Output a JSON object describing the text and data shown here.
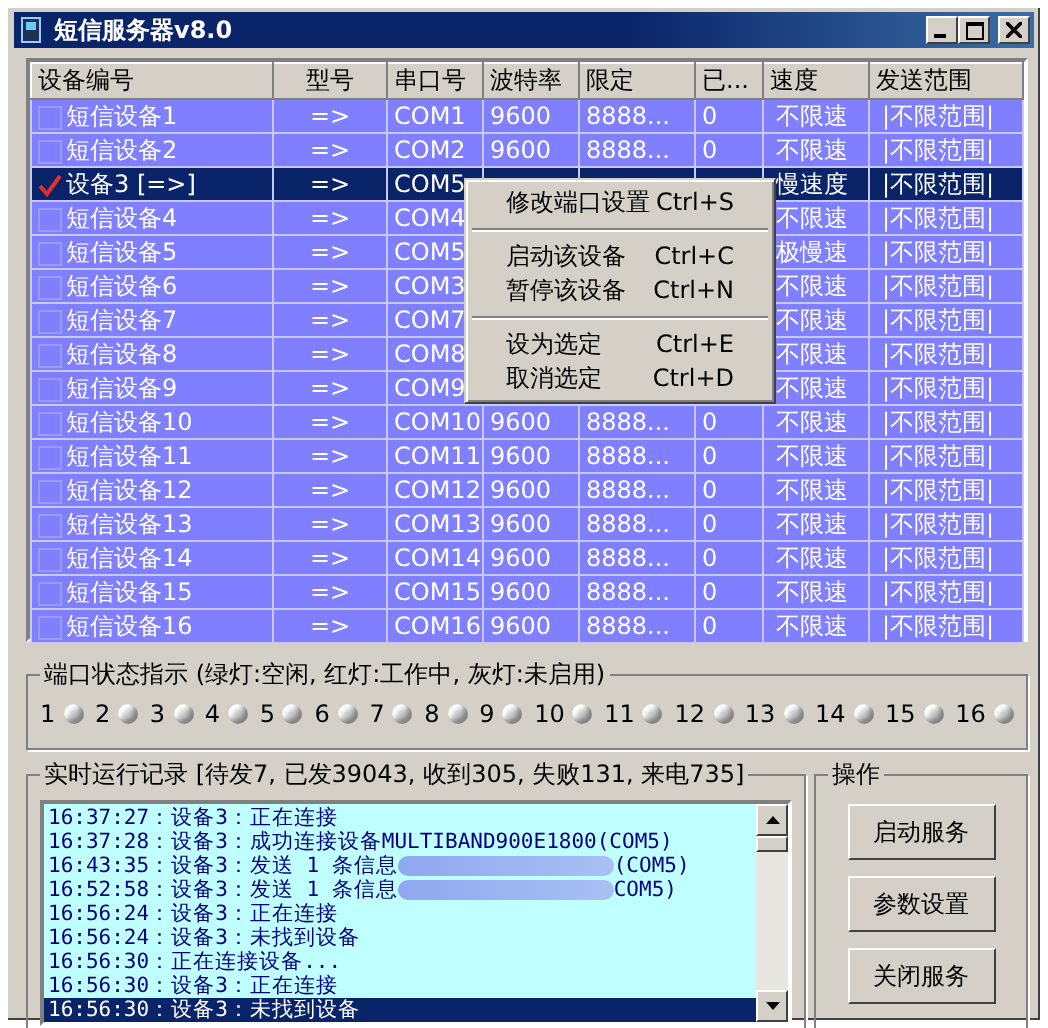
{
  "window": {
    "title": "短信服务器v8.0"
  },
  "table": {
    "columns": [
      "设备编号",
      "型号",
      "串口号",
      "波特率",
      "限定",
      "已...",
      "速度",
      "发送范围"
    ],
    "rows": [
      {
        "checked": false,
        "selected": false,
        "cells": {
          "name": "短信设备1",
          "model": "=>",
          "port": "COM1",
          "baud": "9600",
          "limit": "8888...",
          "sent": "0",
          "speed": "不限速",
          "range": "|不限范围|"
        }
      },
      {
        "checked": false,
        "selected": false,
        "cells": {
          "name": "短信设备2",
          "model": "=>",
          "port": "COM2",
          "baud": "9600",
          "limit": "8888...",
          "sent": "0",
          "speed": "不限速",
          "range": "|不限范围|"
        }
      },
      {
        "checked": true,
        "selected": true,
        "cells": {
          "name": "设备3 [=>]",
          "model": "=>",
          "port": "COM5",
          "speed": "慢速度",
          "range": "|不限范围|"
        }
      },
      {
        "checked": false,
        "selected": false,
        "cells": {
          "name": "短信设备4",
          "model": "=>",
          "port": "COM4",
          "speed": "不限速",
          "range": "|不限范围|"
        }
      },
      {
        "checked": false,
        "selected": false,
        "cells": {
          "name": "短信设备5",
          "model": "=>",
          "port": "COM5",
          "speed": "极慢速",
          "range": "|不限范围|"
        }
      },
      {
        "checked": false,
        "selected": false,
        "cells": {
          "name": "短信设备6",
          "model": "=>",
          "port": "COM3",
          "speed": "不限速",
          "range": "|不限范围|"
        }
      },
      {
        "checked": false,
        "selected": false,
        "cells": {
          "name": "短信设备7",
          "model": "=>",
          "port": "COM7",
          "speed": "不限速",
          "range": "|不限范围|"
        }
      },
      {
        "checked": false,
        "selected": false,
        "cells": {
          "name": "短信设备8",
          "model": "=>",
          "port": "COM8",
          "speed": "不限速",
          "range": "|不限范围|"
        }
      },
      {
        "checked": false,
        "selected": false,
        "cells": {
          "name": "短信设备9",
          "model": "=>",
          "port": "COM9",
          "speed": "不限速",
          "range": "|不限范围|"
        }
      },
      {
        "checked": false,
        "selected": false,
        "cells": {
          "name": "短信设备10",
          "model": "=>",
          "port": "COM10",
          "baud": "9600",
          "limit": "8888...",
          "sent": "0",
          "speed": "不限速",
          "range": "|不限范围|"
        }
      },
      {
        "checked": false,
        "selected": false,
        "cells": {
          "name": "短信设备11",
          "model": "=>",
          "port": "COM11",
          "baud": "9600",
          "limit": "8888...",
          "sent": "0",
          "speed": "不限速",
          "range": "|不限范围|"
        }
      },
      {
        "checked": false,
        "selected": false,
        "cells": {
          "name": "短信设备12",
          "model": "=>",
          "port": "COM12",
          "baud": "9600",
          "limit": "8888...",
          "sent": "0",
          "speed": "不限速",
          "range": "|不限范围|"
        }
      },
      {
        "checked": false,
        "selected": false,
        "cells": {
          "name": "短信设备13",
          "model": "=>",
          "port": "COM13",
          "baud": "9600",
          "limit": "8888...",
          "sent": "0",
          "speed": "不限速",
          "range": "|不限范围|"
        }
      },
      {
        "checked": false,
        "selected": false,
        "cells": {
          "name": "短信设备14",
          "model": "=>",
          "port": "COM14",
          "baud": "9600",
          "limit": "8888...",
          "sent": "0",
          "speed": "不限速",
          "range": "|不限范围|"
        }
      },
      {
        "checked": false,
        "selected": false,
        "cells": {
          "name": "短信设备15",
          "model": "=>",
          "port": "COM15",
          "baud": "9600",
          "limit": "8888...",
          "sent": "0",
          "speed": "不限速",
          "range": "|不限范围|"
        }
      },
      {
        "checked": false,
        "selected": false,
        "cells": {
          "name": "短信设备16",
          "model": "=>",
          "port": "COM16",
          "baud": "9600",
          "limit": "8888...",
          "sent": "0",
          "speed": "不限速",
          "range": "|不限范围|"
        }
      }
    ]
  },
  "context_menu": {
    "items": [
      {
        "kind": "item",
        "label": "修改端口设置",
        "shortcut": "Ctrl+S"
      },
      {
        "kind": "separator"
      },
      {
        "kind": "item",
        "label": "启动该设备",
        "shortcut": "Ctrl+C"
      },
      {
        "kind": "item",
        "label": "暂停该设备",
        "shortcut": "Ctrl+N"
      },
      {
        "kind": "separator"
      },
      {
        "kind": "item",
        "label": "设为选定",
        "shortcut": "Ctrl+E"
      },
      {
        "kind": "item",
        "label": "取消选定",
        "shortcut": "Ctrl+D"
      }
    ]
  },
  "port_status": {
    "title": "端口状态指示 (绿灯:空闲, 红灯:工作中, 灰灯:未启用)",
    "ports": [
      {
        "label": "1",
        "color": "#c8c8c8"
      },
      {
        "label": "2",
        "color": "#c8c8c8"
      },
      {
        "label": "3",
        "color": "#c8c8c8"
      },
      {
        "label": "4",
        "color": "#c8c8c8"
      },
      {
        "label": "5",
        "color": "#c8c8c8"
      },
      {
        "label": "6",
        "color": "#c8c8c8"
      },
      {
        "label": "7",
        "color": "#c8c8c8"
      },
      {
        "label": "8",
        "color": "#c8c8c8"
      },
      {
        "label": "9",
        "color": "#c8c8c8"
      },
      {
        "label": "10",
        "color": "#c8c8c8"
      },
      {
        "label": "11",
        "color": "#c8c8c8"
      },
      {
        "label": "12",
        "color": "#c8c8c8"
      },
      {
        "label": "13",
        "color": "#c8c8c8"
      },
      {
        "label": "14",
        "color": "#c8c8c8"
      },
      {
        "label": "15",
        "color": "#c8c8c8"
      },
      {
        "label": "16",
        "color": "#c8c8c8"
      }
    ]
  },
  "log": {
    "title": "实时运行记录 [待发7, 已发39043, 收到305, 失败131, 来电735]",
    "lines": [
      {
        "text": "16:37:27：设备3：正在连接",
        "selected": false
      },
      {
        "text": "16:37:28：设备3：成功连接设备MULTIBAND900E1800(COM5)",
        "selected": false
      },
      {
        "text": "16:43:35：设备3：发送 1 条信息",
        "redacted": true,
        "after": "(COM5)",
        "selected": false
      },
      {
        "text": "16:52:58：设备3：发送 1 条信息",
        "redacted": true,
        "after": "COM5)",
        "selected": false
      },
      {
        "text": "16:56:24：设备3：正在连接",
        "selected": false
      },
      {
        "text": "16:56:24：设备3：未找到设备",
        "selected": false
      },
      {
        "text": "16:56:30：正在连接设备...",
        "selected": false
      },
      {
        "text": "16:56:30：设备3：正在连接",
        "selected": false
      },
      {
        "text": "16:56:30：设备3：未找到设备",
        "selected": true
      }
    ]
  },
  "operations": {
    "title": "操作",
    "buttons": [
      "启动服务",
      "参数设置",
      "关闭服务"
    ]
  }
}
